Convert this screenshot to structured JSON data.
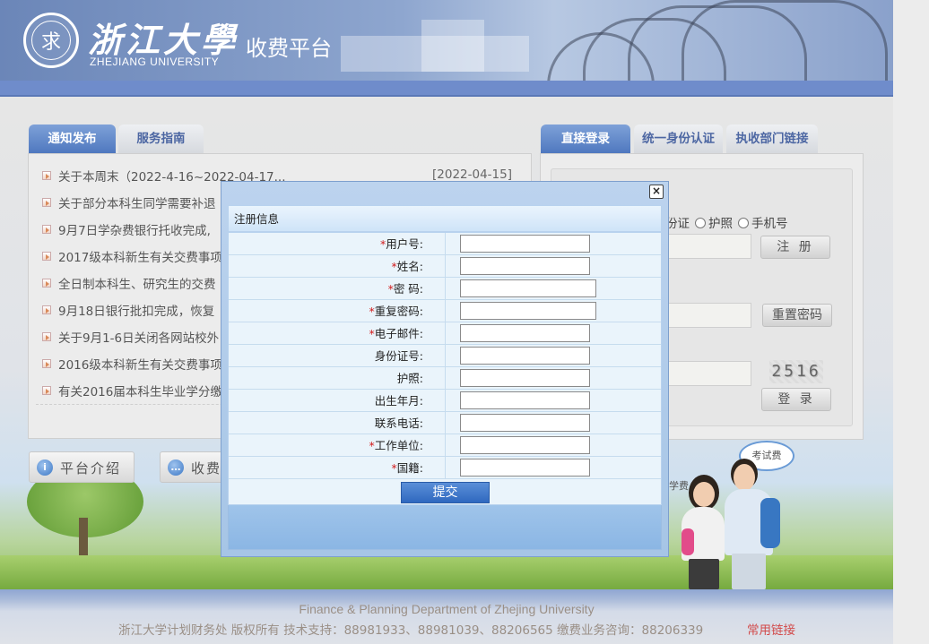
{
  "header": {
    "logo_cn": "浙江大學",
    "logo_en": "ZHEJIANG UNIVERSITY",
    "platform_title": "收费平台"
  },
  "notice_panel": {
    "tabs": [
      {
        "label": "通知发布",
        "active": true
      },
      {
        "label": "服务指南",
        "active": false
      }
    ],
    "items": [
      "关于本周末（2022-4-16~2022-04-17...",
      "关于部分本科生同学需要补退",
      "9月7日学杂费银行托收完成,",
      "2017级本科新生有关交费事项",
      "全日制本科生、研究生的交费",
      "9月18日银行批扣完成，恢复",
      "关于9月1-6日关闭各网站校外",
      "2016级本科新生有关交费事项",
      "有关2016届本科生毕业学分缴"
    ],
    "first_item_date": "[2022-04-15]"
  },
  "bottom_buttons": {
    "platform_intro": "平台介绍",
    "fee_partial": "收费"
  },
  "login_panel": {
    "tabs": [
      {
        "label": "直接登录",
        "active": true
      },
      {
        "label": "统一身份认证",
        "active": false
      },
      {
        "label": "执收部门链接",
        "active": false
      }
    ],
    "radio_partial": "份证",
    "radio_passport": "护照",
    "radio_phone": "手机号",
    "register_label": "注 册",
    "reset_password_label": "重置密码",
    "captcha_text": "2516",
    "login_label": "登 录"
  },
  "illustration": {
    "bubble_text": "考试费",
    "partial_text": "学费"
  },
  "modal": {
    "title": "注册信息",
    "close_glyph": "×",
    "fields": [
      {
        "label": "用户号:",
        "required": true
      },
      {
        "label": "姓名:",
        "required": true
      },
      {
        "label": "密 码:",
        "required": true
      },
      {
        "label": "重复密码:",
        "required": true
      },
      {
        "label": "电子邮件:",
        "required": true
      },
      {
        "label": "身份证号:",
        "required": false
      },
      {
        "label": "护照:",
        "required": false
      },
      {
        "label": "出生年月:",
        "required": false
      },
      {
        "label": "联系电话:",
        "required": false
      },
      {
        "label": "工作单位:",
        "required": true
      },
      {
        "label": "国籍:",
        "required": true
      }
    ],
    "submit_label": "提交"
  },
  "footer": {
    "english": "Finance & Planning Department of Zhejing University",
    "chinese": "浙江大学计划财务处 版权所有   技术支持：88981933、88981039、88206565 缴费业务咨询：88206339",
    "link": "常用链接"
  },
  "colors": {
    "header_blue": "#6f8ccb",
    "tab_active": "#4f78bf",
    "required_star": "#d21c1c",
    "submit_blue": "#2f68bf"
  }
}
